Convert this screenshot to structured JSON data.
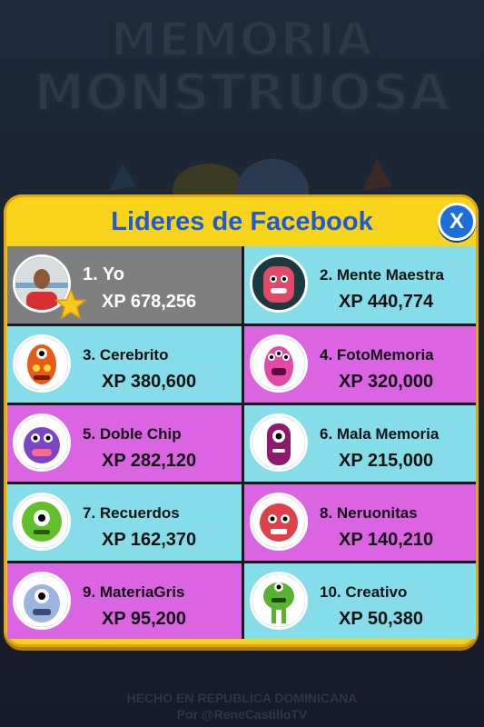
{
  "background": {
    "title_line1": "MEMORIA",
    "title_line2": "MONSTRUOSA",
    "footer_line1": "HECHO EN REPUBLICA DOMINICANA",
    "footer_line2": "Por @ReneCastilloTV"
  },
  "dialog": {
    "title": "Lideres de Facebook",
    "close_label": "X",
    "leaders": [
      {
        "name": "1. Yo",
        "xp": "XP 678,256",
        "avatar": "user-photo"
      },
      {
        "name": "2. Mente Maestra",
        "xp": "XP 440,774",
        "avatar": "pink-monster"
      },
      {
        "name": "3. Cerebrito",
        "xp": "XP 380,600",
        "avatar": "orange-monster"
      },
      {
        "name": "4. FotoMemoria",
        "xp": "XP 320,000",
        "avatar": "pink-three-eyed-monster"
      },
      {
        "name": "5. Doble Chip",
        "xp": "XP 282,120",
        "avatar": "purple-monster"
      },
      {
        "name": "6. Mala Memoria",
        "xp": "XP 215,000",
        "avatar": "magenta-cyclops-monster"
      },
      {
        "name": "7. Recuerdos",
        "xp": "XP 162,370",
        "avatar": "green-cyclops-monster"
      },
      {
        "name": "8. Neruonitas",
        "xp": "XP 140,210",
        "avatar": "red-fuzzy-monster"
      },
      {
        "name": "9. MateriaGris",
        "xp": "XP 95,200",
        "avatar": "blue-monster"
      },
      {
        "name": "10. Creativo",
        "xp": "XP 50,380",
        "avatar": "green-tall-monster"
      }
    ]
  },
  "colors": {
    "panel": "#f7d41a",
    "title": "#1e5bd6",
    "cyan_cell": "#84dde8",
    "pink_cell": "#db64e3",
    "self_cell": "#7f7f7f"
  }
}
